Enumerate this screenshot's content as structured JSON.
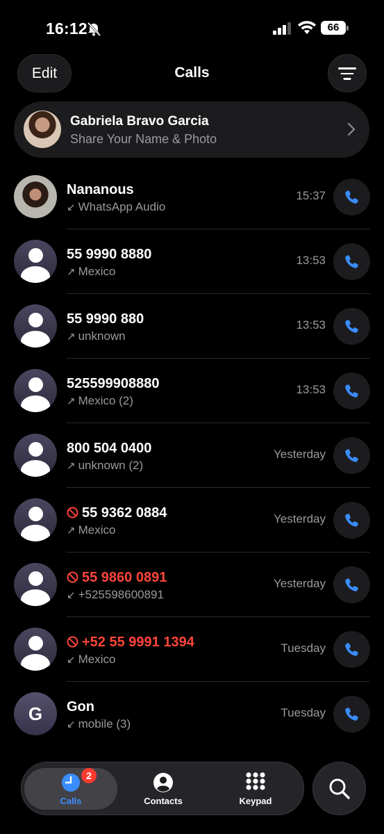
{
  "status_bar": {
    "time": "16:12",
    "battery": "66"
  },
  "header": {
    "edit_label": "Edit",
    "title": "Calls"
  },
  "profile": {
    "name": "Gabriela Bravo Garcia",
    "subtitle": "Share Your Name & Photo"
  },
  "calls": [
    {
      "name": "Nananous",
      "detail": "WhatsApp Audio",
      "direction": "incoming",
      "time": "15:37",
      "avatar": "photo",
      "blocked": false,
      "missed": false
    },
    {
      "name": "55 9990 8880",
      "detail": "Mexico",
      "direction": "outgoing",
      "time": "13:53",
      "avatar": "person",
      "blocked": false,
      "missed": false
    },
    {
      "name": "55 9990 880",
      "detail": "unknown",
      "direction": "outgoing",
      "time": "13:53",
      "avatar": "person",
      "blocked": false,
      "missed": false
    },
    {
      "name": "525599908880",
      "detail": "Mexico (2)",
      "direction": "outgoing",
      "time": "13:53",
      "avatar": "person",
      "blocked": false,
      "missed": false
    },
    {
      "name": "800 504 0400",
      "detail": "unknown (2)",
      "direction": "outgoing",
      "time": "Yesterday",
      "avatar": "person",
      "blocked": false,
      "missed": false
    },
    {
      "name": "55 9362 0884",
      "detail": "Mexico",
      "direction": "outgoing",
      "time": "Yesterday",
      "avatar": "person",
      "blocked": true,
      "missed": false
    },
    {
      "name": "55 9860 0891",
      "detail": "+525598600891",
      "direction": "incoming",
      "time": "Yesterday",
      "avatar": "person",
      "blocked": true,
      "missed": true
    },
    {
      "name": "+52 55 9991 1394",
      "detail": "Mexico",
      "direction": "incoming",
      "time": "Tuesday",
      "avatar": "person",
      "blocked": true,
      "missed": true
    },
    {
      "name": "Gon",
      "detail": "mobile (3)",
      "direction": "incoming",
      "time": "Tuesday",
      "avatar": "letter",
      "avatar_letter": "G",
      "blocked": false,
      "missed": false
    }
  ],
  "tabs": [
    {
      "label": "Calls",
      "badge": "2",
      "icon": "clock-icon",
      "active": true
    },
    {
      "label": "Contacts",
      "icon": "person-circle-icon",
      "active": false
    },
    {
      "label": "Keypad",
      "icon": "keypad-icon",
      "active": false
    }
  ],
  "colors": {
    "accent": "#3a8dff",
    "missed": "#ff453a",
    "badge": "#ff3b30"
  }
}
